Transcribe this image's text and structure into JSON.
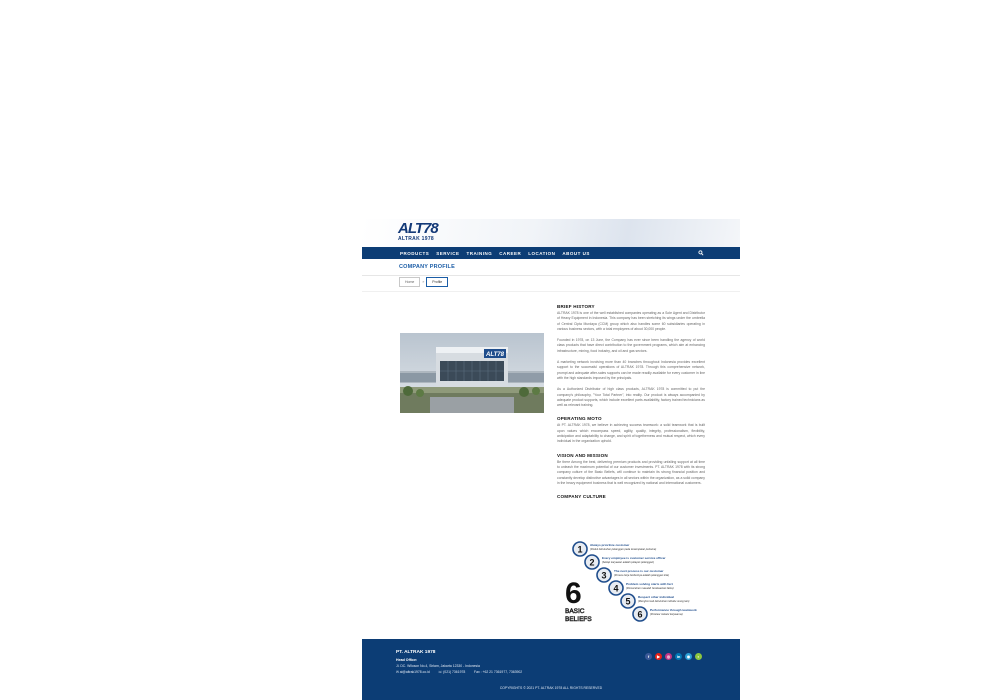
{
  "brand": {
    "logo_mark": "ALT78",
    "logo_sub": "ALTRAK 1978"
  },
  "nav": {
    "items": [
      "PRODUCTS",
      "SERVICE",
      "TRAINING",
      "CAREER",
      "LOCATION",
      "ABOUT US"
    ]
  },
  "page": {
    "title": "COMPANY PROFILE"
  },
  "breadcrumb": {
    "home": "Home",
    "current": "Profile"
  },
  "photo": {
    "sign": "ALT78"
  },
  "sections": {
    "history_title": "BRIEF HISTORY",
    "history_p1": "ALTRAK 1978 is one of the well established companies operating as a Sole Agent and Distributor of Heavy Equipment in Indonesia. This company has been stretching its wings under the umbrella of Central Cipta Murdaya (CCM) group which also handles some 60 subsidiaries operating in various business sectors, with a total employees of about 30,000 people.",
    "history_p2": "Founded in 1978, on 13 June, the Company has ever since been handling the agency of world class products that have direct contribution to the government programs, which aim at enhancing infrastructure, mining, food industry, and oil and gas sectors.",
    "history_p3": "A marketing network involving more than 40 branches throughout Indonesia provides excellent support to the successful operations of ALTRAK 1978. Through this comprehensive network, prompt and adequate after-sales supports can be made readily available for every customer in line with the high standards imposed by the principals.",
    "history_p4": "As a Authorized Distributor of high class products, ALTRAK 1978 is committed to put the company's philosophy, \"Your Total Partner\", into reality. Our product is always accompanied by adequate product supports, which include excellent parts availability, factory trained technicians as well as relevant training.",
    "moto_title": "OPERATING MOTO",
    "moto_p1": "At PT. ALTRAK 1978, we believe in achieving success teamwork: a solid teamwork that is built upon values which encompass speed, agility, quality, integrity, professionalism, flexibility, anticipation and adaptability to change, and spirit of togetherness and mutual respect, which every individual in the organization uphold.",
    "vision_title": "VISION AND MISSION",
    "vision_p1": "Be there Among the best, delivering premium products and providing unfailing support at all time to unleash the maximum potential of our customer investments. PT. ALTRAK 1978 with its strong company culture of the Basic Beliefs, will continue to maintain its strong financial position and constantly develop distinctive advantages in all sectors within the organization, as a solid company in the heavy equipment business that is well recognized by national and international customers.",
    "culture_title": "COMPANY CULTURE"
  },
  "culture": {
    "big_number": "6",
    "big_label_1": "BASIC",
    "big_label_2": "BELIEFS",
    "beliefs": [
      {
        "num": "1",
        "en": "Always prioritize customer",
        "id": "(Peduli kebutuhan pelanggan pada kesempatan pertama)"
      },
      {
        "num": "2",
        "en": "Every employee is customer service officer",
        "id": "(Setiap karyawan adalah pelayan pelanggan)"
      },
      {
        "num": "3",
        "en": "The next process is our customer",
        "id": "(Proses kerja berikutnya adalah pelanggan kita)"
      },
      {
        "num": "4",
        "en": "Problem solving starts with fact",
        "id": "(Pemecahan masalah berdasarkan fakta)"
      },
      {
        "num": "5",
        "en": "Respect other individual",
        "id": "(Menghormati kebutuhan individu orang lain)"
      },
      {
        "num": "6",
        "en": "Performance through teamwork",
        "id": "(Prestasi melalui kerjasama)"
      }
    ]
  },
  "footer": {
    "company": "PT. ALTRAK 1978",
    "head_office_label": "Head Office:",
    "address": "Jl. DC. Wiloson No.4, Sirlam, Jakarta 12330 - Indonesia",
    "email": "✉ ai@altrak1978.co.id",
    "phone": "☏ (021) 7361978",
    "fax": "Fax : +62 21 7361977, 7363902",
    "copyright": "COPYRIGHTS © 2021 PT. ALTRAK 1978 ALL RIGHTS RESERVED",
    "socials": [
      "f",
      "▶",
      "◎",
      "in",
      "◉",
      "◐"
    ]
  },
  "colors": {
    "navy": "#0c3d75",
    "accent_blue": "#1b5da6",
    "text_gray": "#666666"
  },
  "icons": {
    "search": "search-icon",
    "socials": [
      "facebook-icon",
      "youtube-icon",
      "instagram-icon",
      "linkedin-icon",
      "web-icon",
      "app-icon"
    ]
  }
}
